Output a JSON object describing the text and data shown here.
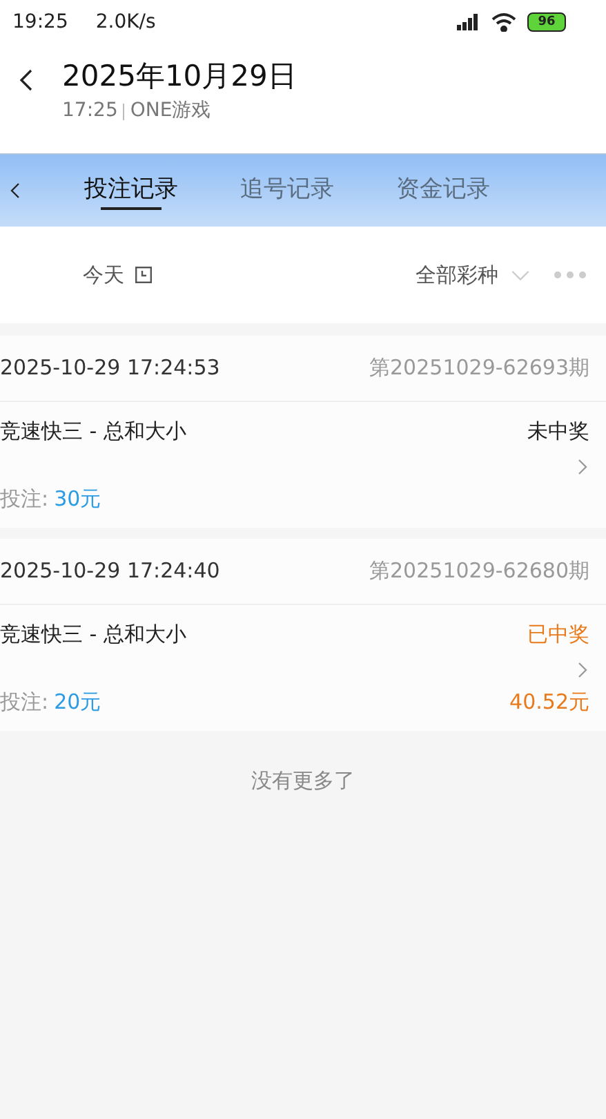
{
  "status_bar": {
    "time": "19:25",
    "speed": "2.0K/s",
    "battery": "96"
  },
  "header": {
    "title": "2025年10月29日",
    "time": "17:25",
    "app": "ONE游戏"
  },
  "tabs": [
    {
      "label": "投注记录",
      "selected": true
    },
    {
      "label": "追号记录",
      "selected": false
    },
    {
      "label": "资金记录",
      "selected": false
    }
  ],
  "filters": {
    "date": "今天",
    "game": "全部彩种"
  },
  "records": [
    {
      "datetime": "2025-10-29 17:24:53",
      "issue": "第20251029-62693期",
      "game": "竞速快三 - 总和大小",
      "status": "未中奖",
      "won": false,
      "bet_label": "投注:",
      "bet": "30元"
    },
    {
      "datetime": "2025-10-29 17:24:40",
      "issue": "第20251029-62680期",
      "game": "竞速快三 - 总和大小",
      "status": "已中奖",
      "won": true,
      "bet_label": "投注:",
      "bet": "20元",
      "payout": "40.52元"
    }
  ],
  "footer": "没有更多了"
}
